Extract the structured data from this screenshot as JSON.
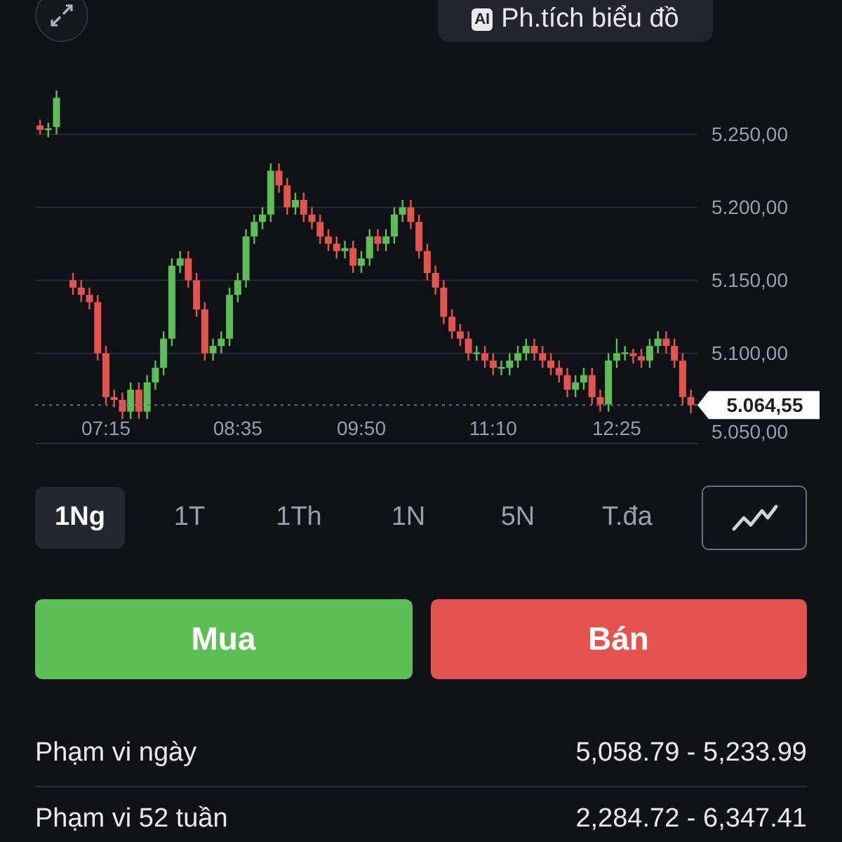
{
  "header": {
    "ai_button": {
      "badge": "AI",
      "label": "Ph.tích biểu đồ"
    }
  },
  "chart": {
    "chart_data": {
      "type": "candlestick",
      "xlim": [
        392,
        794
      ],
      "ylim": [
        5038.5,
        5250
      ],
      "grid": true,
      "ref_lines": [
        {
          "axis": "y",
          "value": 5064.55,
          "label": "5.064,55"
        }
      ],
      "x": [
        395,
        400,
        405,
        415,
        420,
        425,
        430,
        435,
        440,
        445,
        450,
        455,
        460,
        465,
        470,
        475,
        480,
        485,
        490,
        495,
        500,
        505,
        510,
        515,
        520,
        525,
        530,
        535,
        540,
        545,
        550,
        555,
        560,
        565,
        570,
        575,
        580,
        585,
        590,
        595,
        600,
        605,
        610,
        615,
        620,
        625,
        630,
        635,
        640,
        645,
        650,
        655,
        660,
        665,
        670,
        675,
        680,
        685,
        690,
        695,
        700,
        705,
        710,
        715,
        720,
        725,
        730,
        735,
        740,
        745,
        750,
        755,
        760,
        765,
        770,
        775,
        780,
        785,
        790
      ],
      "ohlc": [
        [
          5256,
          5260,
          5250,
          5253
        ],
        [
          5253,
          5258,
          5248,
          5254
        ],
        [
          5255,
          5280,
          5250,
          5275
        ],
        [
          5150,
          5155,
          5140,
          5145
        ],
        [
          5145,
          5150,
          5135,
          5140
        ],
        [
          5140,
          5145,
          5130,
          5135
        ],
        [
          5135,
          5140,
          5095,
          5100
        ],
        [
          5100,
          5105,
          5065,
          5070
        ],
        [
          5070,
          5075,
          5063,
          5068
        ],
        [
          5068,
          5073,
          5055,
          5060
        ],
        [
          5060,
          5080,
          5055,
          5075
        ],
        [
          5075,
          5080,
          5055,
          5060
        ],
        [
          5060,
          5085,
          5055,
          5080
        ],
        [
          5080,
          5095,
          5075,
          5090
        ],
        [
          5090,
          5115,
          5085,
          5110
        ],
        [
          5110,
          5165,
          5105,
          5160
        ],
        [
          5160,
          5170,
          5155,
          5165
        ],
        [
          5165,
          5170,
          5145,
          5150
        ],
        [
          5150,
          5155,
          5125,
          5130
        ],
        [
          5130,
          5135,
          5095,
          5100
        ],
        [
          5100,
          5110,
          5095,
          5105
        ],
        [
          5105,
          5115,
          5100,
          5110
        ],
        [
          5110,
          5145,
          5105,
          5140
        ],
        [
          5140,
          5155,
          5135,
          5150
        ],
        [
          5150,
          5185,
          5145,
          5180
        ],
        [
          5180,
          5195,
          5175,
          5190
        ],
        [
          5190,
          5200,
          5185,
          5195
        ],
        [
          5195,
          5230,
          5190,
          5225
        ],
        [
          5225,
          5230,
          5210,
          5215
        ],
        [
          5215,
          5220,
          5195,
          5200
        ],
        [
          5200,
          5210,
          5195,
          5205
        ],
        [
          5205,
          5210,
          5190,
          5195
        ],
        [
          5195,
          5200,
          5185,
          5190
        ],
        [
          5190,
          5195,
          5175,
          5180
        ],
        [
          5180,
          5185,
          5170,
          5175
        ],
        [
          5175,
          5180,
          5165,
          5170
        ],
        [
          5170,
          5177,
          5165,
          5172
        ],
        [
          5172,
          5177,
          5155,
          5160
        ],
        [
          5160,
          5170,
          5155,
          5165
        ],
        [
          5165,
          5185,
          5160,
          5180
        ],
        [
          5180,
          5185,
          5170,
          5175
        ],
        [
          5175,
          5185,
          5170,
          5180
        ],
        [
          5180,
          5200,
          5175,
          5195
        ],
        [
          5195,
          5205,
          5190,
          5200
        ],
        [
          5200,
          5205,
          5185,
          5190
        ],
        [
          5190,
          5195,
          5165,
          5170
        ],
        [
          5170,
          5175,
          5150,
          5155
        ],
        [
          5155,
          5160,
          5140,
          5145
        ],
        [
          5145,
          5150,
          5120,
          5125
        ],
        [
          5125,
          5130,
          5110,
          5115
        ],
        [
          5115,
          5120,
          5105,
          5110
        ],
        [
          5110,
          5115,
          5095,
          5100
        ],
        [
          5100,
          5105,
          5095,
          5100
        ],
        [
          5100,
          5105,
          5090,
          5095
        ],
        [
          5095,
          5100,
          5085,
          5090
        ],
        [
          5090,
          5095,
          5085,
          5090
        ],
        [
          5090,
          5100,
          5085,
          5095
        ],
        [
          5095,
          5105,
          5090,
          5100
        ],
        [
          5100,
          5110,
          5095,
          5105
        ],
        [
          5105,
          5110,
          5095,
          5100
        ],
        [
          5100,
          5105,
          5090,
          5095
        ],
        [
          5095,
          5100,
          5085,
          5090
        ],
        [
          5090,
          5095,
          5080,
          5085
        ],
        [
          5085,
          5090,
          5070,
          5075
        ],
        [
          5075,
          5085,
          5070,
          5080
        ],
        [
          5080,
          5090,
          5075,
          5085
        ],
        [
          5085,
          5090,
          5065,
          5070
        ],
        [
          5070,
          5075,
          5060,
          5065
        ],
        [
          5065,
          5100,
          5060,
          5095
        ],
        [
          5095,
          5110,
          5090,
          5100
        ],
        [
          5100,
          5105,
          5095,
          5100
        ],
        [
          5100,
          5103,
          5093,
          5098
        ],
        [
          5098,
          5103,
          5090,
          5095
        ],
        [
          5095,
          5110,
          5090,
          5105
        ],
        [
          5105,
          5115,
          5100,
          5110
        ],
        [
          5110,
          5115,
          5100,
          5105
        ],
        [
          5105,
          5110,
          5090,
          5095
        ],
        [
          5095,
          5100,
          5065,
          5070
        ],
        [
          5070,
          5075,
          5058.79,
          5064.55
        ]
      ],
      "xticks": [
        {
          "value": 435,
          "label": "07:15"
        },
        {
          "value": 515,
          "label": "08:35"
        },
        {
          "value": 590,
          "label": "09:50"
        },
        {
          "value": 670,
          "label": "11:10"
        },
        {
          "value": 745,
          "label": "12:25"
        }
      ],
      "yticks": [
        {
          "value": 5250,
          "label": "5.250,00"
        },
        {
          "value": 5200,
          "label": "5.200,00"
        },
        {
          "value": 5150,
          "label": "5.150,00"
        },
        {
          "value": 5100,
          "label": "5.100,00"
        },
        {
          "value": 5050,
          "label": "5.050,00"
        }
      ]
    }
  },
  "ranges": [
    {
      "label": "1Ng",
      "selected": true
    },
    {
      "label": "1T",
      "selected": false
    },
    {
      "label": "1Th",
      "selected": false
    },
    {
      "label": "1N",
      "selected": false
    },
    {
      "label": "5N",
      "selected": false
    },
    {
      "label": "T.đa",
      "selected": false
    }
  ],
  "actions": [
    {
      "label": "Mua",
      "kind": "buy"
    },
    {
      "label": "Bán",
      "kind": "sell"
    }
  ],
  "stats": [
    {
      "label": "Phạm vi ngày",
      "value": "5,058.79 - 5,233.99"
    },
    {
      "label": "Phạm vi 52 tuần",
      "value": "2,284.72 - 6,347.41"
    }
  ]
}
